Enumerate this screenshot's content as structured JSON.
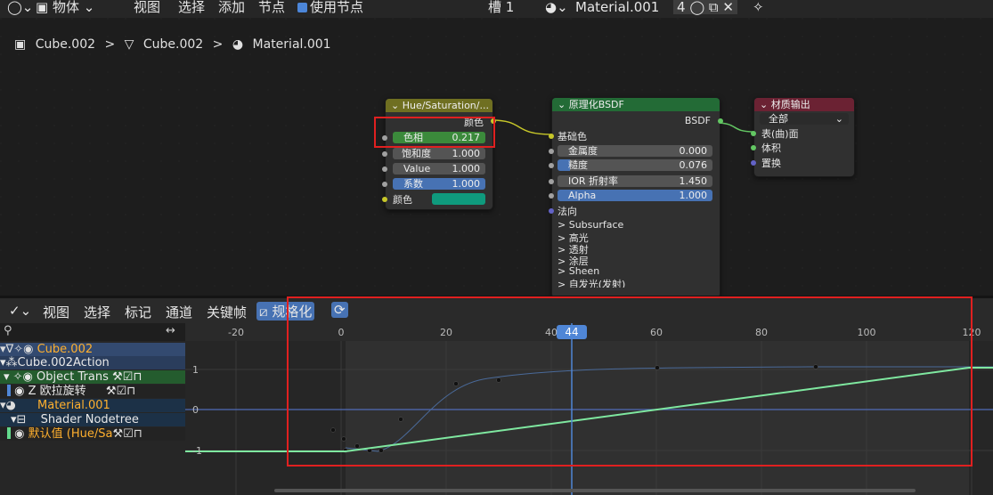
{
  "topbar": {
    "mode": "物体",
    "menus": [
      "视图",
      "选择",
      "添加",
      "节点"
    ],
    "use_nodes": "使用节点",
    "slot": "槽 1",
    "material": "Material.001",
    "user_count": "4"
  },
  "breadcrumb": {
    "object": "Cube.002",
    "mesh": "Cube.002",
    "material": "Material.001",
    "sep": ">"
  },
  "nodes": {
    "hue_sat": {
      "title": "Hue/Saturation/...",
      "output_color": "颜色",
      "hue_label": "色相",
      "hue_value": "0.217",
      "sat_label": "饱和度",
      "sat_value": "1.000",
      "value_label": "Value",
      "value_value": "1.000",
      "fac_label": "系数",
      "fac_value": "1.000",
      "input_color": "颜色",
      "swatch_color": "#0f9a7d"
    },
    "bsdf": {
      "title": "原理化BSDF",
      "output": "BSDF",
      "base_color": "基础色",
      "metallic_label": "金属度",
      "metallic_value": "0.000",
      "roughness_label": "糙度",
      "roughness_value": "0.076",
      "ior_label": "IOR 折射率",
      "ior_value": "1.450",
      "alpha_label": "Alpha",
      "alpha_value": "1.000",
      "normal": "法向",
      "panels": [
        "> Subsurface",
        "> 高光",
        "> 透射",
        "> 涂层",
        "> Sheen",
        "> 自发光(发射)"
      ]
    },
    "output": {
      "title": "材质输出",
      "target": "全部",
      "surface": "表(曲)面",
      "volume": "体积",
      "displacement": "置换"
    }
  },
  "graph_editor": {
    "menus": [
      "视图",
      "选择",
      "标记",
      "通道",
      "关键帧"
    ],
    "normalize": "规格化",
    "search_placeholder": "",
    "frame_labels": [
      "-20",
      "0",
      "20",
      "40",
      "60",
      "80",
      "100",
      "120"
    ],
    "current_frame": "44",
    "y_labels": [
      "1",
      "0",
      "-1"
    ],
    "channels": [
      "Cube.002",
      "Cube.002Action",
      "Object Trans",
      "Z 欧拉旋转",
      "Material.001",
      "Shader Nodetree",
      "默认值 (Hue/Sa"
    ],
    "colors": {
      "accent": "#4772b3",
      "curve": "#7fe8a0",
      "highlight": "#e02020",
      "frame_indicator": "#4f86d6"
    }
  }
}
